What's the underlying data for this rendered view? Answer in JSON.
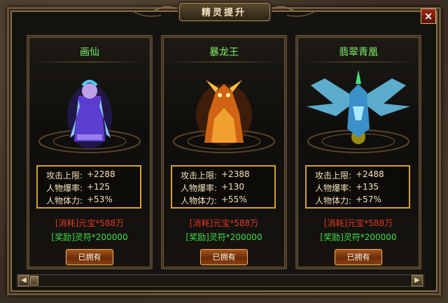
{
  "window": {
    "title": "精灵提升",
    "close_label": "×"
  },
  "cards": [
    {
      "name": "画仙",
      "pet_icon": "fairy-painter-icon",
      "stats": [
        {
          "label": "攻击上限:",
          "value": "+2288"
        },
        {
          "label": "人物爆率:",
          "value": "+125"
        },
        {
          "label": "人物体力:",
          "value": "+53%"
        }
      ],
      "cost": "[消耗]元宝*588万",
      "reward": "[奖励]灵符*200000",
      "button_label": "已拥有"
    },
    {
      "name": "暴龙王",
      "pet_icon": "fire-dragon-icon",
      "stats": [
        {
          "label": "攻击上限:",
          "value": "+2388"
        },
        {
          "label": "人物爆率:",
          "value": "+130"
        },
        {
          "label": "人物体力:",
          "value": "+55%"
        }
      ],
      "cost": "[消耗]元宝*588万",
      "reward": "[奖励]灵符*200000",
      "button_label": "已拥有"
    },
    {
      "name": "翡翠青凰",
      "pet_icon": "jade-phoenix-icon",
      "stats": [
        {
          "label": "攻击上限:",
          "value": "+2488"
        },
        {
          "label": "人物爆率:",
          "value": "+135"
        },
        {
          "label": "人物体力:",
          "value": "+57%"
        }
      ],
      "cost": "[消耗]元宝*588万",
      "reward": "[奖励]灵符*200000",
      "button_label": "已拥有"
    }
  ],
  "scrollbar": {
    "left_arrow": "◀",
    "right_arrow": "▶"
  },
  "colors": {
    "name": "#7ef06a",
    "cost": "#e23a26",
    "reward": "#3ee04a",
    "stat_border": "#d4a22c"
  }
}
